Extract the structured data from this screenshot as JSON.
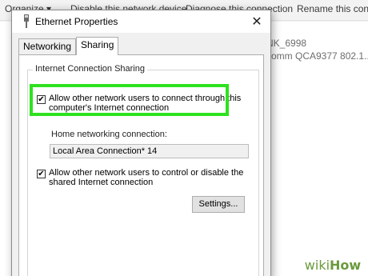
{
  "background_window": {
    "toolbar": {
      "organize_label": "Organize ▾",
      "disable_label": "Disable this network device",
      "diagnose_label": "Diagnose this connection",
      "rename_label": "Rename this con"
    },
    "adapter_name": "NK_6998",
    "adapter_desc": "comm QCA9377 802.1..."
  },
  "dialog": {
    "title": "Ethernet Properties",
    "close_glyph": "✕",
    "tabs": [
      {
        "label": "Networking",
        "active": false
      },
      {
        "label": "Sharing",
        "active": true
      }
    ],
    "group_title": "Internet Connection Sharing",
    "allow_connect": {
      "checked": true,
      "label_line1": "Allow other network users to connect through this",
      "label_line2": "computer's Internet connection"
    },
    "home_network_label": "Home networking connection:",
    "home_network_value": "Local Area Connection* 14",
    "allow_control": {
      "checked": true,
      "label_line1": "Allow other network users to control or disable the",
      "label_line2": "shared Internet connection"
    },
    "settings_label": "Settings...",
    "checkmark": "✔"
  },
  "watermark": {
    "part1": "wiki",
    "part2": "How"
  },
  "colors": {
    "highlight": "#2ee21e",
    "watermark": "#6a9a3c"
  }
}
